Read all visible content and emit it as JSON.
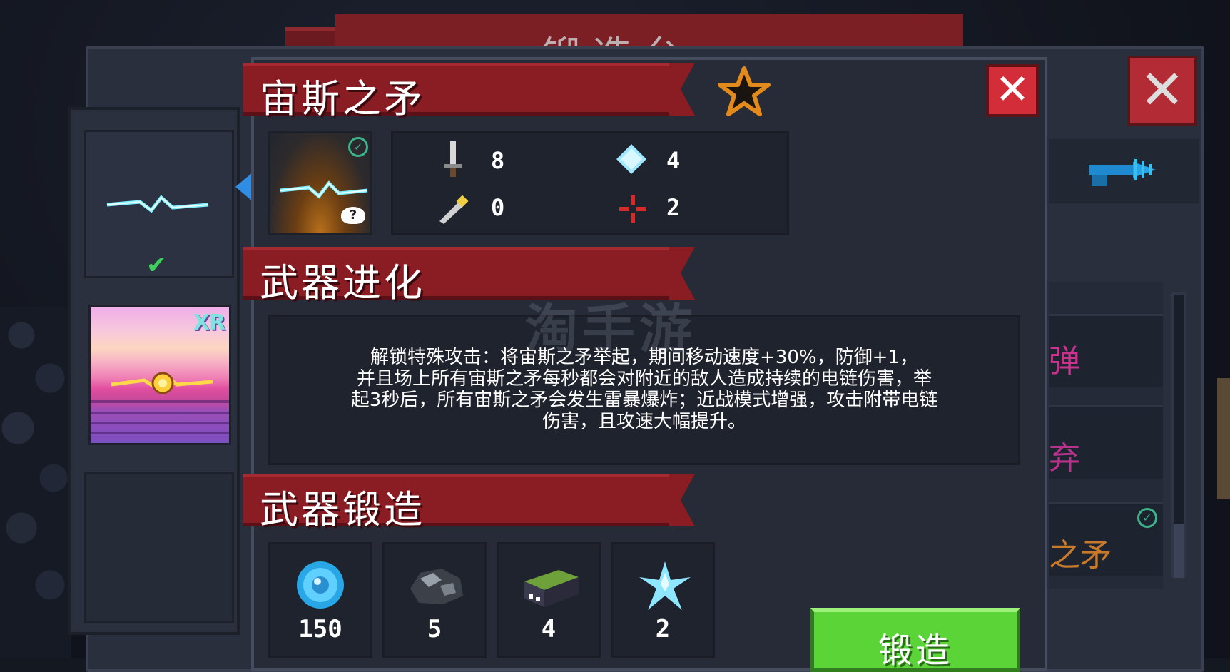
{
  "background": {
    "title": "锻造台",
    "right_list": [
      "弹",
      "弃",
      "之矛"
    ]
  },
  "weapon": {
    "name": "宙斯之矛",
    "stats": {
      "damage": "8",
      "energy": "4",
      "crit": "0",
      "inaccuracy": "2"
    }
  },
  "sections": {
    "evolution_title": "武器进化",
    "forge_title": "武器锻造"
  },
  "evolution": {
    "line1": "解锁特殊攻击：将宙斯之矛举起，期间移动速度+30%，防御+1，",
    "line2": "并且场上所有宙斯之矛每秒都会对附近的敌人造成持续的电链伤害，举",
    "line3": "起3秒后，所有宙斯之矛会发生雷暴爆炸；近战模式增强，攻击附带电链",
    "line4": "伤害，且攻速大幅提升。"
  },
  "materials": [
    {
      "icon": "blue-gem-coin-icon",
      "count": "150"
    },
    {
      "icon": "ore-icon",
      "count": "5"
    },
    {
      "icon": "battery-icon",
      "count": "4"
    },
    {
      "icon": "crystal-shard-icon",
      "count": "2"
    }
  ],
  "buttons": {
    "forge": "锻造"
  },
  "xr_card": {
    "badge": "XR"
  },
  "watermark": "淘手游",
  "colors": {
    "ribbon": "#8a1c23",
    "forge_button": "#5ad437",
    "close_button": "#d22d39",
    "lightning": "#7ff0ff"
  }
}
